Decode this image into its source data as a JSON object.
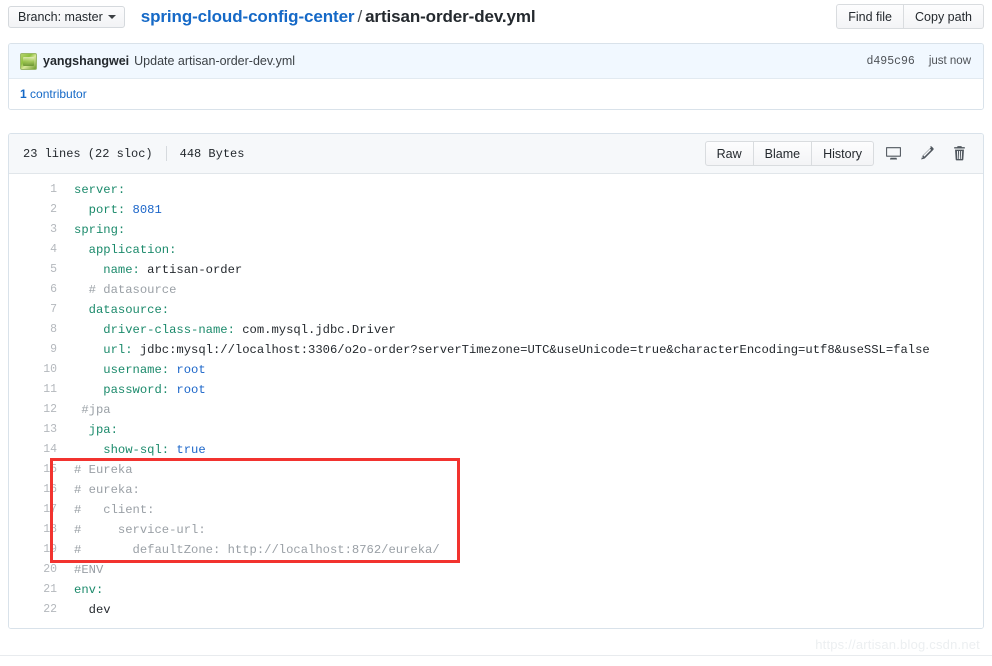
{
  "topbar": {
    "branch_label": "Branch: master",
    "branch_caret": "chevron-down-icon",
    "repo_name": "spring-cloud-config-center",
    "separator": "/",
    "file_name": "artisan-order-dev.yml",
    "find_file_label": "Find file",
    "copy_path_label": "Copy path"
  },
  "commit": {
    "author": "yangshangwei",
    "message": "Update artisan-order-dev.yml",
    "sha": "d495c96",
    "time": "just now",
    "contributors_count": "1",
    "contributors_label": "contributor"
  },
  "file": {
    "lines_info": "23 lines (22 sloc)",
    "size": "448 Bytes",
    "raw_label": "Raw",
    "blame_label": "Blame",
    "history_label": "History",
    "desktop_icon": "desktop-icon",
    "edit_icon": "pencil-icon",
    "delete_icon": "trash-icon"
  },
  "code": {
    "lines": [
      {
        "n": "1",
        "segments": [
          {
            "t": "server:",
            "c": "k"
          }
        ]
      },
      {
        "n": "2",
        "segments": [
          {
            "t": "  port: ",
            "c": "k"
          },
          {
            "t": "8081",
            "c": "v"
          }
        ]
      },
      {
        "n": "3",
        "segments": [
          {
            "t": "spring:",
            "c": "k"
          }
        ]
      },
      {
        "n": "4",
        "segments": [
          {
            "t": "  application:",
            "c": "k"
          }
        ]
      },
      {
        "n": "5",
        "segments": [
          {
            "t": "    name: ",
            "c": "k"
          },
          {
            "t": "artisan-order",
            "c": "s"
          }
        ]
      },
      {
        "n": "6",
        "segments": [
          {
            "t": "  # datasource",
            "c": "c"
          }
        ]
      },
      {
        "n": "7",
        "segments": [
          {
            "t": "  datasource:",
            "c": "k"
          }
        ]
      },
      {
        "n": "8",
        "segments": [
          {
            "t": "    driver-class-name: ",
            "c": "k"
          },
          {
            "t": "com.mysql.jdbc.Driver",
            "c": "s"
          }
        ]
      },
      {
        "n": "9",
        "segments": [
          {
            "t": "    url: ",
            "c": "k"
          },
          {
            "t": "jdbc:mysql://localhost:3306/o2o-order?serverTimezone=UTC&useUnicode=true&characterEncoding=utf8&useSSL=false",
            "c": "s"
          }
        ]
      },
      {
        "n": "10",
        "segments": [
          {
            "t": "    username: ",
            "c": "k"
          },
          {
            "t": "root",
            "c": "v"
          }
        ]
      },
      {
        "n": "11",
        "segments": [
          {
            "t": "    password: ",
            "c": "k"
          },
          {
            "t": "root",
            "c": "v"
          }
        ]
      },
      {
        "n": "12",
        "segments": [
          {
            "t": " #jpa",
            "c": "c"
          }
        ]
      },
      {
        "n": "13",
        "segments": [
          {
            "t": "  jpa:",
            "c": "k"
          }
        ]
      },
      {
        "n": "14",
        "segments": [
          {
            "t": "    show-sql: ",
            "c": "k"
          },
          {
            "t": "true",
            "c": "v"
          }
        ]
      },
      {
        "n": "15",
        "segments": [
          {
            "t": "# Eureka",
            "c": "c"
          }
        ]
      },
      {
        "n": "16",
        "segments": [
          {
            "t": "# eureka:",
            "c": "c"
          }
        ]
      },
      {
        "n": "17",
        "segments": [
          {
            "t": "#   client:",
            "c": "c"
          }
        ]
      },
      {
        "n": "18",
        "segments": [
          {
            "t": "#     service-url:",
            "c": "c"
          }
        ]
      },
      {
        "n": "19",
        "segments": [
          {
            "t": "#       defaultZone: http://localhost:8762/eureka/",
            "c": "c"
          }
        ]
      },
      {
        "n": "20",
        "segments": [
          {
            "t": "#ENV",
            "c": "c"
          }
        ]
      },
      {
        "n": "21",
        "segments": [
          {
            "t": "env:",
            "c": "k"
          }
        ]
      },
      {
        "n": "22",
        "segments": [
          {
            "t": "  dev",
            "c": "s"
          }
        ]
      }
    ]
  },
  "annotation": {
    "red_box_name": "highlight-rectangle",
    "color": "#f2332f"
  },
  "watermark": {
    "text": "https://artisan.blog.csdn.net"
  }
}
